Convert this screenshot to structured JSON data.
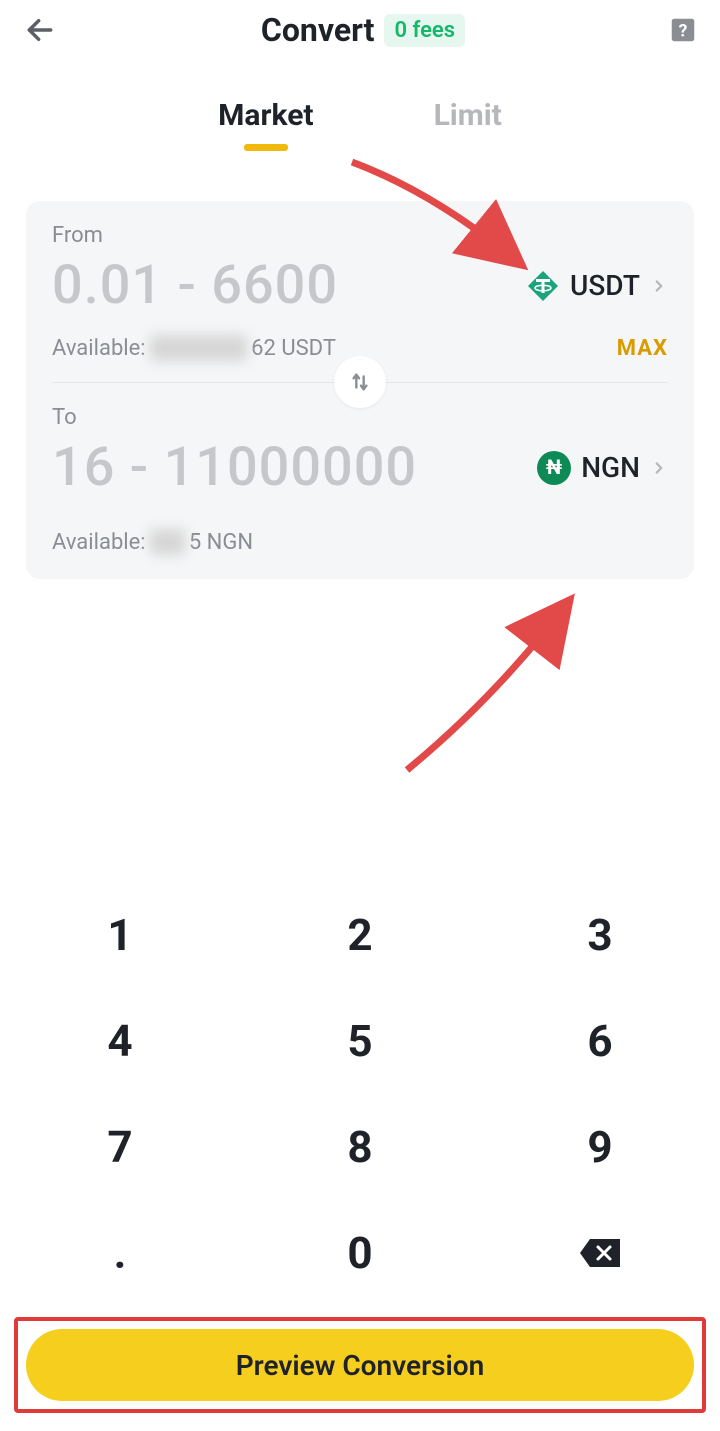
{
  "header": {
    "title": "Convert",
    "fees_badge": "0 fees"
  },
  "tabs": {
    "market": "Market",
    "limit": "Limit"
  },
  "from": {
    "label": "From",
    "placeholder": "0.01 - 6600",
    "available_prefix": "Available:",
    "available_hidden": "██████",
    "available_suffix": "62 USDT",
    "currency": "USDT",
    "max_label": "MAX"
  },
  "to": {
    "label": "To",
    "placeholder": "16 - 11000000",
    "available_prefix": "Available:",
    "available_hidden": "██",
    "available_suffix": "5 NGN",
    "currency": "NGN"
  },
  "keypad": {
    "k1": "1",
    "k2": "2",
    "k3": "3",
    "k4": "4",
    "k5": "5",
    "k6": "6",
    "k7": "7",
    "k8": "8",
    "k9": "9",
    "kdot": ".",
    "k0": "0"
  },
  "cta": {
    "label": "Preview Conversion"
  }
}
